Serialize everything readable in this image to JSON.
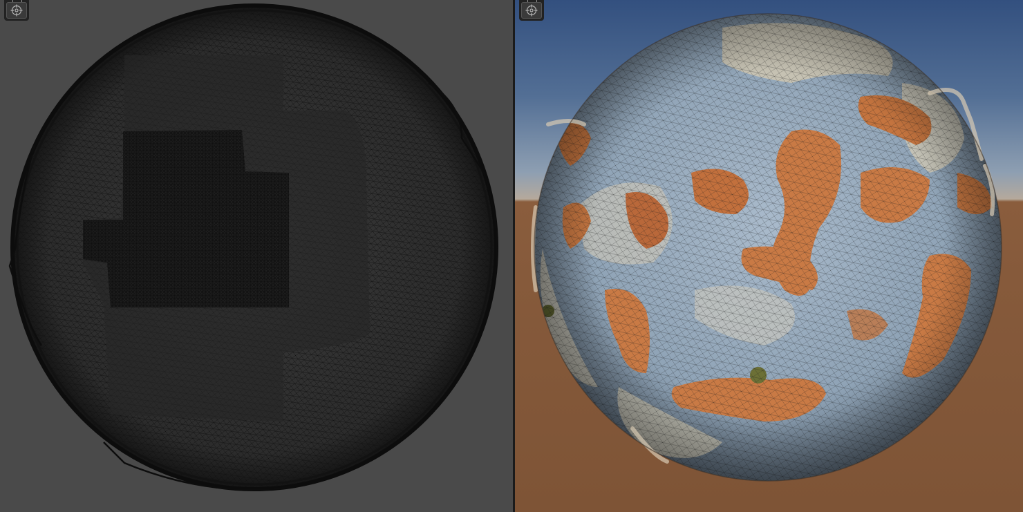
{
  "viewports": [
    {
      "mode": "wireframe",
      "background_color": "#4a4a4a",
      "wire_color": "#0d0d0d",
      "toolbar_icon": "orbit-gizmo-icon"
    },
    {
      "mode": "textured-wireframe",
      "sky_top_color": "#33507f",
      "ground_color": "#865a3b",
      "ocean_color": "#8fa3b6",
      "land_color": "#c97a45",
      "sand_color": "#cfc7b2",
      "toolbar_icon": "orbit-gizmo-icon"
    }
  ]
}
